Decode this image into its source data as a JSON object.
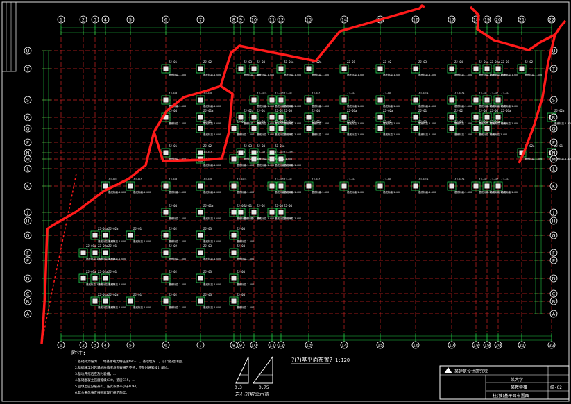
{
  "drawing": {
    "grid_numbers": [
      "1",
      "2",
      "3",
      "4",
      "5",
      "6",
      "7",
      "8",
      "9",
      "10",
      "11",
      "12",
      "13",
      "14",
      "15",
      "16",
      "17",
      "18",
      "19",
      "20",
      "21",
      "22"
    ],
    "grid_letters_top_to_bottom": [
      "U",
      "T",
      "S",
      "R",
      "Q",
      "P",
      "N",
      "M",
      "L",
      "K",
      "J",
      "H",
      "G",
      "F",
      "E",
      "D",
      "C",
      "B",
      "A"
    ],
    "column_tags": [
      "ZJ-01",
      "ZJ-02",
      "ZJ-03",
      "ZJ-04",
      "ZJ-01a",
      "ZJ-02a"
    ],
    "level_note": "基底标高-1.400",
    "title": "?(?)基平面布置?",
    "scale": "1:120",
    "legend_label": "岩石放坡率示意",
    "slope_values": [
      "0.3",
      "0.75"
    ],
    "notes_heading": "附注:",
    "notes_lines": [
      "1.基础持力层为...，地基承载力特征值fak=...，基础埋深...，见(?)基础详图。",
      "2.基础施工时若遇地质情况与勘察报告不符，应及时通知设计单位。",
      "3.基坑开挖后应及时验槽，...",
      "4.基础混凝土强度等级C30，垫层C15，...",
      "5.回填土应分层夯实，压实系数不小于0.94。",
      "6.其余未尽事宜按国家现行规范施工。"
    ],
    "titleblock": {
      "institute": "某建筑设计研究院",
      "project": "某大学",
      "subproject": "某教学楼",
      "sheet_name": "柱(独)基平面布置图",
      "sheet_no": "结-02"
    }
  },
  "colors": {
    "background": "#000000",
    "axis_line": "#cc2222",
    "dim_line": "#22cc44",
    "footing": "#e8e8e8",
    "outline_red": "#ff1a1a",
    "text": "#ffffff"
  }
}
